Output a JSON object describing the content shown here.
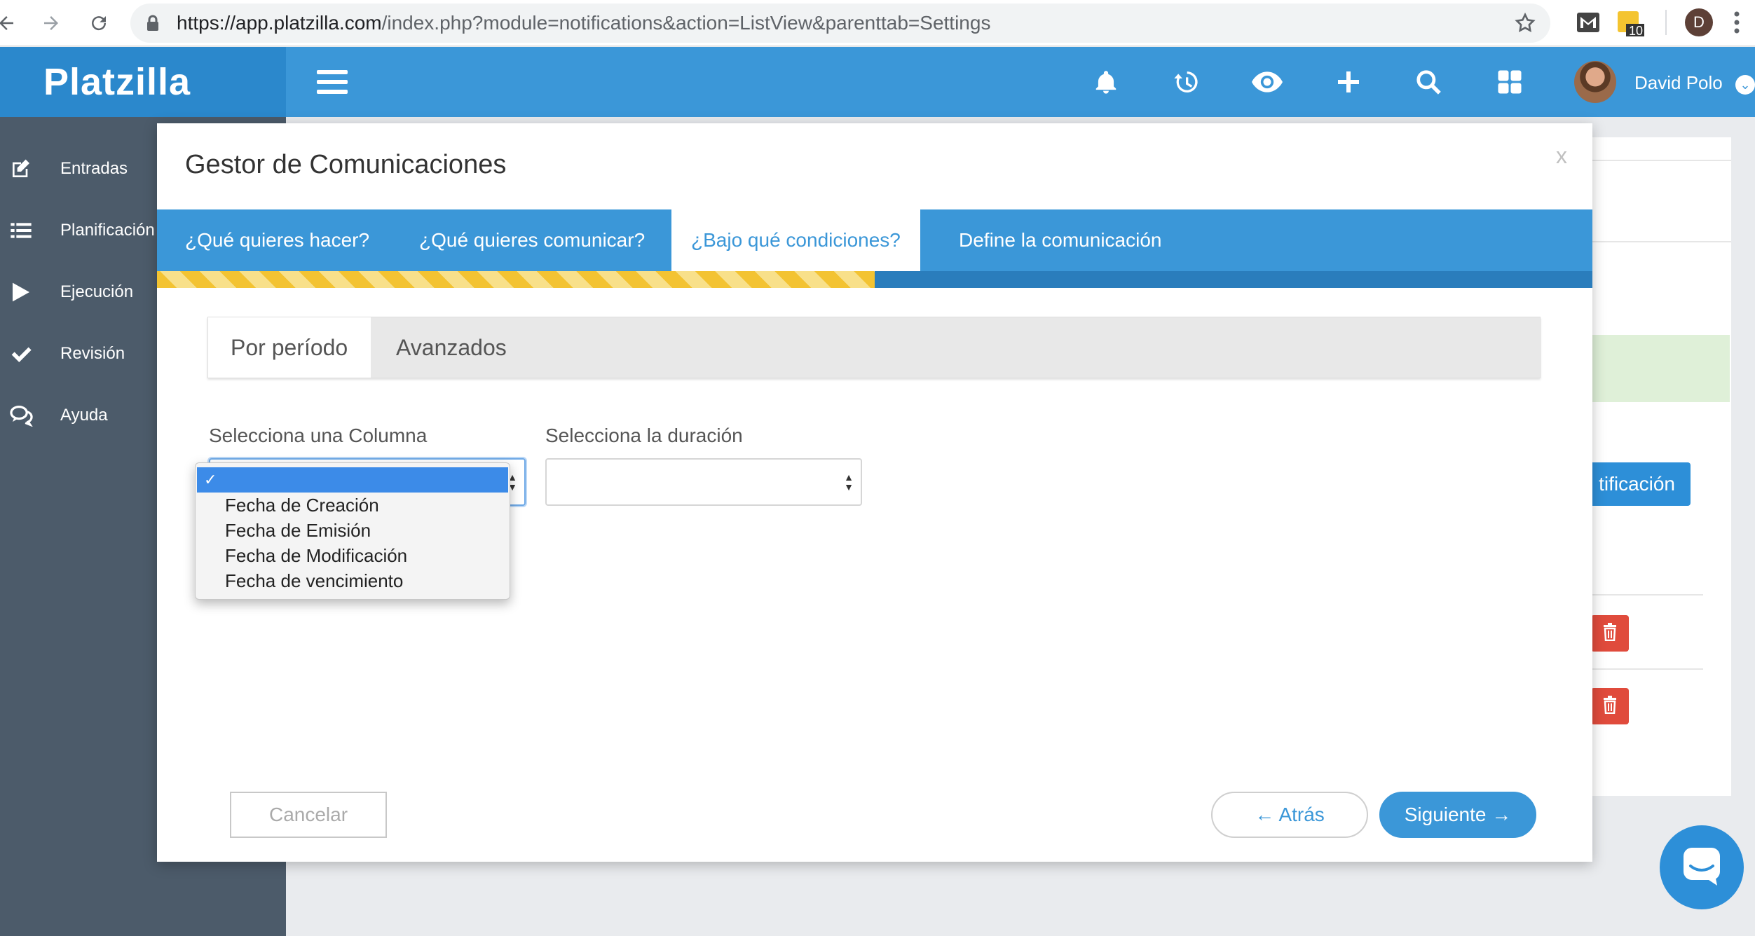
{
  "browser": {
    "url_host": "https://app.platzilla.com",
    "url_path": "/index.php?module=notifications&action=ListView&parenttab=Settings",
    "extension_badge": "10",
    "profile_initial": "D"
  },
  "header": {
    "brand": "Platzilla",
    "user_name": "David Polo",
    "icons": [
      "bell-icon",
      "history-icon",
      "eye-icon",
      "plus-icon",
      "search-icon",
      "grid-icon"
    ]
  },
  "sidebar": {
    "items": [
      {
        "label": "Entradas",
        "icon": "edit-icon"
      },
      {
        "label": "Planificación",
        "icon": "list-icon"
      },
      {
        "label": "Ejecución",
        "icon": "play-icon"
      },
      {
        "label": "Revisión",
        "icon": "check-icon"
      },
      {
        "label": "Ayuda",
        "icon": "chat-icon"
      }
    ]
  },
  "background": {
    "button_label": "tificación"
  },
  "modal": {
    "title": "Gestor de Comunicaciones",
    "close": "x",
    "wizard_steps": [
      {
        "label": "¿Qué quieres hacer?"
      },
      {
        "label": "¿Qué quieres comunicar?"
      },
      {
        "label": "¿Bajo qué condiciones?",
        "active": true
      },
      {
        "label": "Define la comunicación"
      }
    ],
    "progress": 0.5,
    "subtabs": [
      {
        "label": "Por período",
        "active": true
      },
      {
        "label": "Avanzados"
      }
    ],
    "column_label": "Selecciona una Columna",
    "duration_label": "Selecciona la duración",
    "column_options": [
      {
        "label": "",
        "selected": true
      },
      {
        "label": "Fecha de Creación"
      },
      {
        "label": "Fecha de Emisión"
      },
      {
        "label": "Fecha de Modificación"
      },
      {
        "label": "Fecha de vencimiento"
      }
    ],
    "buttons": {
      "cancel": "Cancelar",
      "back": "← Atrás",
      "next": "Siguiente →"
    }
  },
  "colors": {
    "primary": "#3b97d8",
    "sidebar": "#4c5b6a",
    "progress_stripe": "#f3c332",
    "danger": "#e04b3c"
  }
}
